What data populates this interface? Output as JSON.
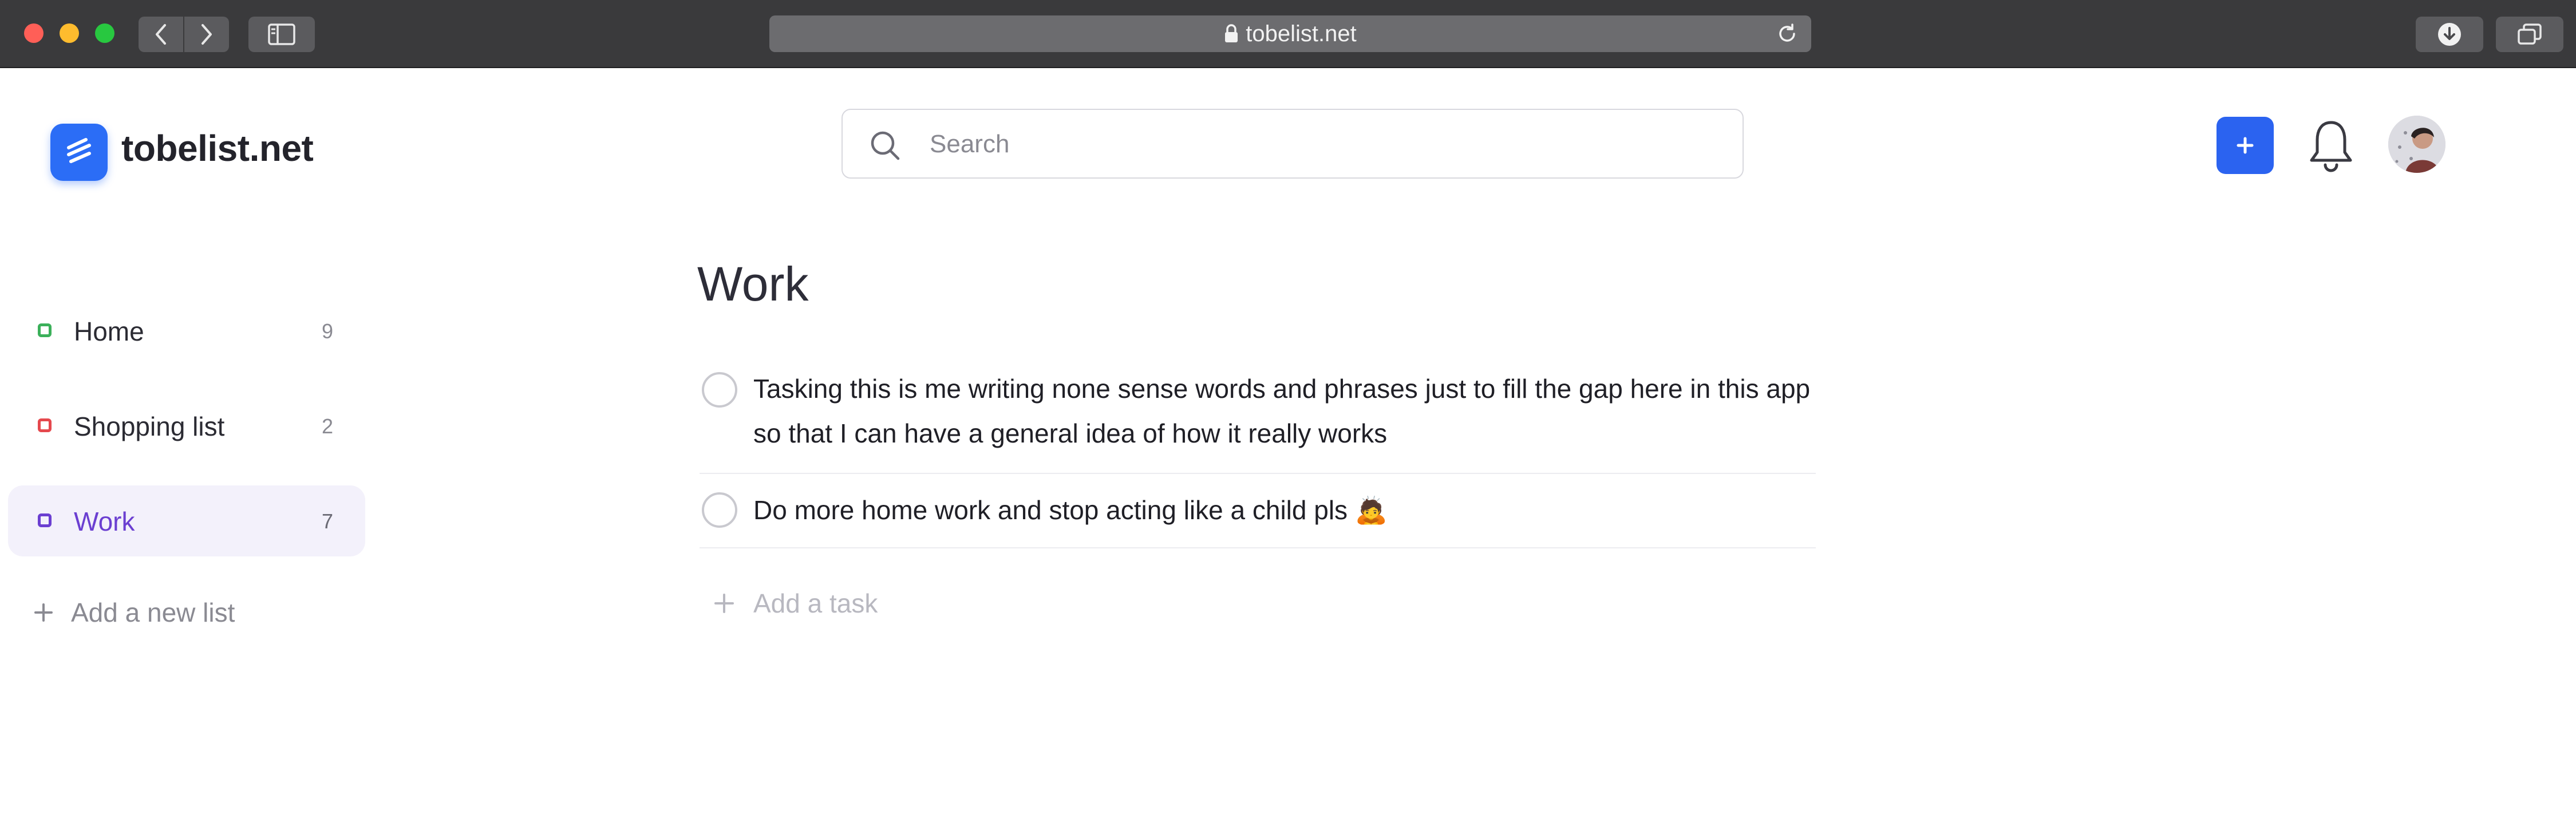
{
  "browser": {
    "url": "tobelist.net"
  },
  "app": {
    "name": "tobelist.net"
  },
  "search": {
    "placeholder": "Search"
  },
  "sidebar": {
    "lists": [
      {
        "label": "Home",
        "count": "9",
        "color": "#3bb05a"
      },
      {
        "label": "Shopping list",
        "count": "2",
        "color": "#e5484d"
      },
      {
        "label": "Work",
        "count": "7",
        "color": "#6b3fd1",
        "active": true
      }
    ],
    "add_list_label": "Add a new list"
  },
  "main": {
    "title": "Work",
    "tasks": [
      {
        "text": "Tasking this is me writing none sense words and phrases just to fill the gap here in this app so that I can have a general idea of how it really works",
        "completed": false
      },
      {
        "text": "Do more home work and stop acting like a child pls 🙇",
        "completed": false
      }
    ],
    "add_task_label": "Add a task"
  },
  "colors": {
    "accent": "#2b63f0",
    "active_list": "#6b3fd1",
    "chrome": "#3a3a3c"
  },
  "icons": [
    "lock-icon",
    "reload-icon",
    "search-icon",
    "plus-icon",
    "bell-icon",
    "chevron-left-icon",
    "chevron-right-icon",
    "sidebar-icon",
    "download-icon",
    "tabs-icon"
  ]
}
